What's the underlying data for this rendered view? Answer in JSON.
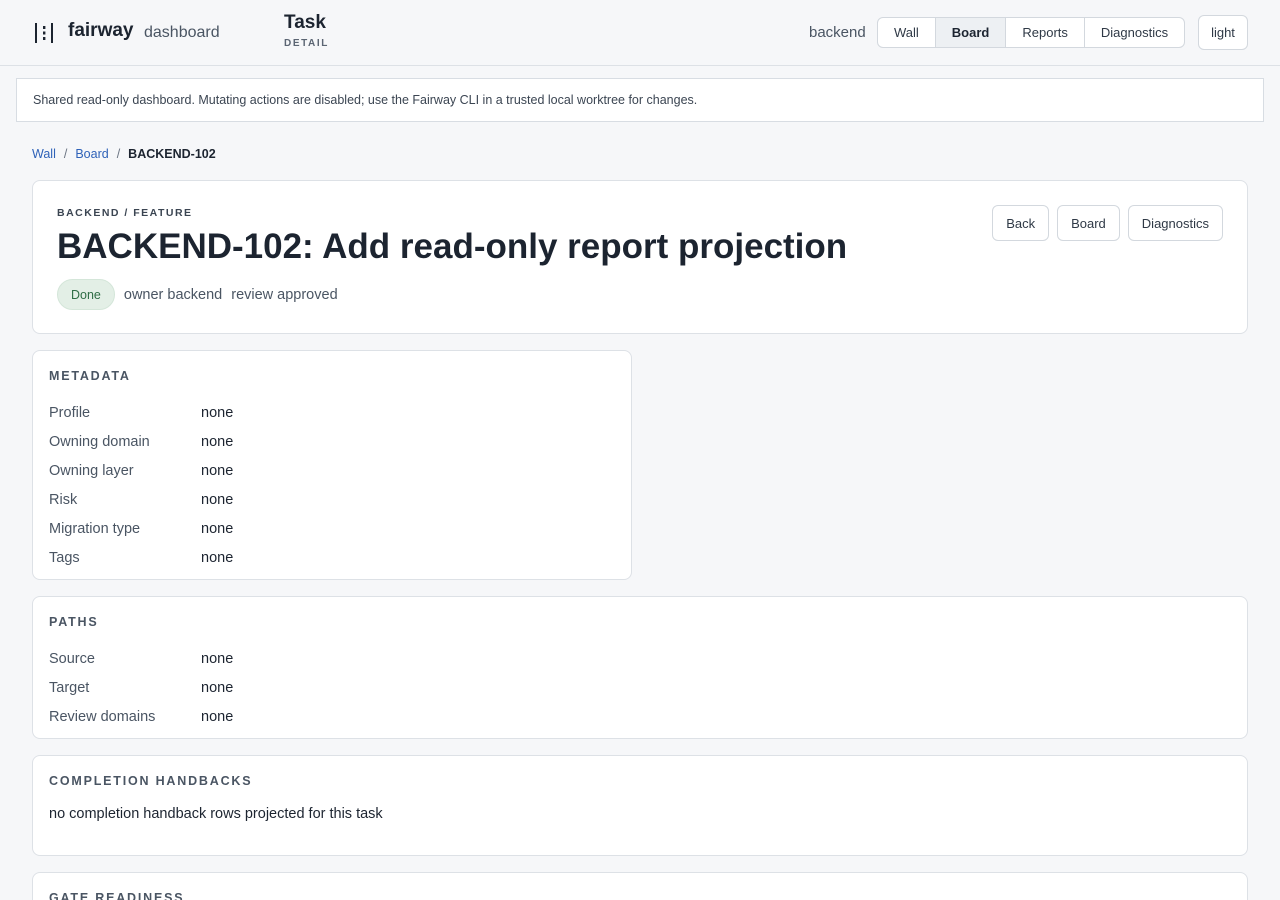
{
  "header": {
    "brand_name": "fairway",
    "brand_sub": "dashboard",
    "page_kind": "Task",
    "page_kind_sub": "DETAIL",
    "workspace": "backend",
    "tabs": [
      {
        "label": "Wall"
      },
      {
        "label": "Board"
      },
      {
        "label": "Reports"
      },
      {
        "label": "Diagnostics"
      }
    ],
    "active_tab": "Board",
    "theme_label": "light"
  },
  "notice": "Shared read-only dashboard. Mutating actions are disabled; use the Fairway CLI in a trusted local worktree for changes.",
  "breadcrumb": {
    "items": [
      "Wall",
      "Board"
    ],
    "separator": "/",
    "current": "BACKEND-102"
  },
  "task": {
    "kicker": "BACKEND / FEATURE",
    "title": "BACKEND-102: Add read-only report projection",
    "status": "Done",
    "owner": "owner backend",
    "review": "review approved",
    "actions": [
      "Back",
      "Board",
      "Diagnostics"
    ]
  },
  "metadata": {
    "title": "METADATA",
    "rows": [
      {
        "key": "Profile",
        "value": "none"
      },
      {
        "key": "Owning domain",
        "value": "none"
      },
      {
        "key": "Owning layer",
        "value": "none"
      },
      {
        "key": "Risk",
        "value": "none"
      },
      {
        "key": "Migration type",
        "value": "none"
      },
      {
        "key": "Tags",
        "value": "none"
      }
    ]
  },
  "paths": {
    "title": "PATHS",
    "rows": [
      {
        "key": "Source",
        "value": "none"
      },
      {
        "key": "Target",
        "value": "none"
      },
      {
        "key": "Review domains",
        "value": "none"
      }
    ]
  },
  "handbacks": {
    "title": "COMPLETION HANDBACKS",
    "empty_text": "no completion handback rows projected for this task"
  },
  "gate": {
    "title": "GATE READINESS"
  },
  "colors": {
    "accent_link": "#2f62b8",
    "status_done_bg": "#e3efe6",
    "status_done_text": "#2f6d45"
  },
  "icons": {
    "brand": "fairway-logo-icon"
  }
}
